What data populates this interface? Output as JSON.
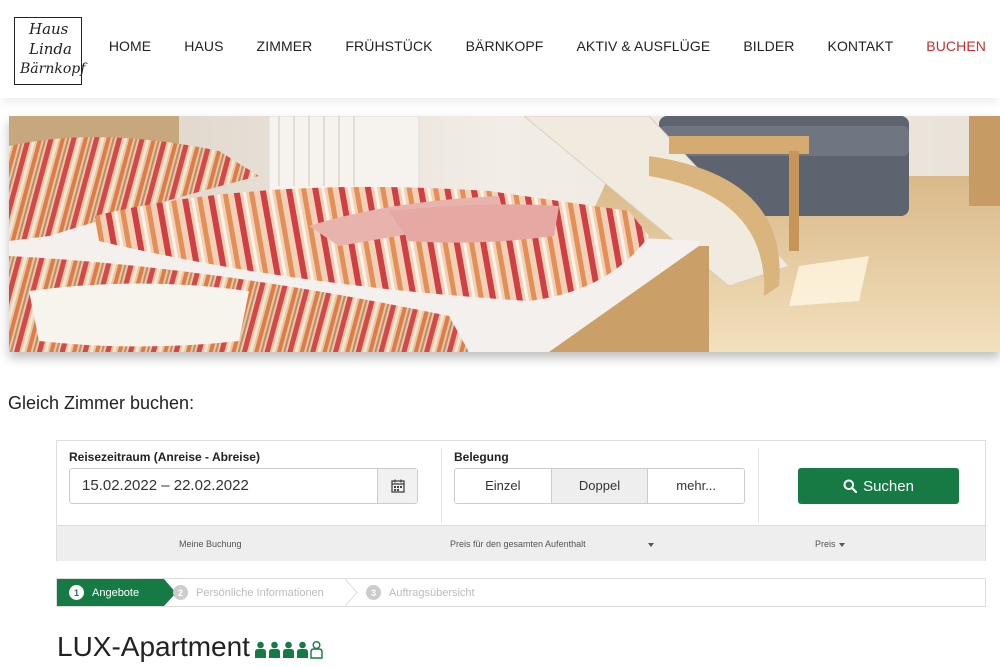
{
  "logo": {
    "line1": "Haus",
    "line2": "Linda",
    "line3": "Bärnkopf"
  },
  "nav": {
    "items": [
      "HOME",
      "HAUS",
      "ZIMMER",
      "FRÜHSTÜCK",
      "BÄRNKOPF",
      "AKTIV & AUSFLÜGE",
      "BILDER",
      "KONTAKT",
      "BUCHEN"
    ],
    "active_index": 8
  },
  "hero": {
    "icon": "bedroom-photo"
  },
  "booking": {
    "heading": "Gleich Zimmer buchen:",
    "date_label": "Reisezeitraum (Anreise - Abreise)",
    "date_value": "15.02.2022 – 22.02.2022",
    "occupancy_label": "Belegung",
    "occupancy_options": [
      "Einzel",
      "Doppel",
      "mehr..."
    ],
    "occupancy_selected": "Doppel",
    "search_label": "Suchen",
    "summary": {
      "booking": "Meine Buchung",
      "price_total": "Preis für den gesamten Aufenthalt",
      "price": "Preis"
    }
  },
  "steps": [
    {
      "num": "1",
      "label": "Angebote"
    },
    {
      "num": "2",
      "label": "Persönliche Informationen"
    },
    {
      "num": "3",
      "label": "Auftragsübersicht"
    }
  ],
  "apartment": {
    "title": "LUX-Apartment",
    "persons_filled": 4,
    "persons_total": 5
  },
  "colors": {
    "accent": "#167a45",
    "nav_active": "#c0302c"
  }
}
